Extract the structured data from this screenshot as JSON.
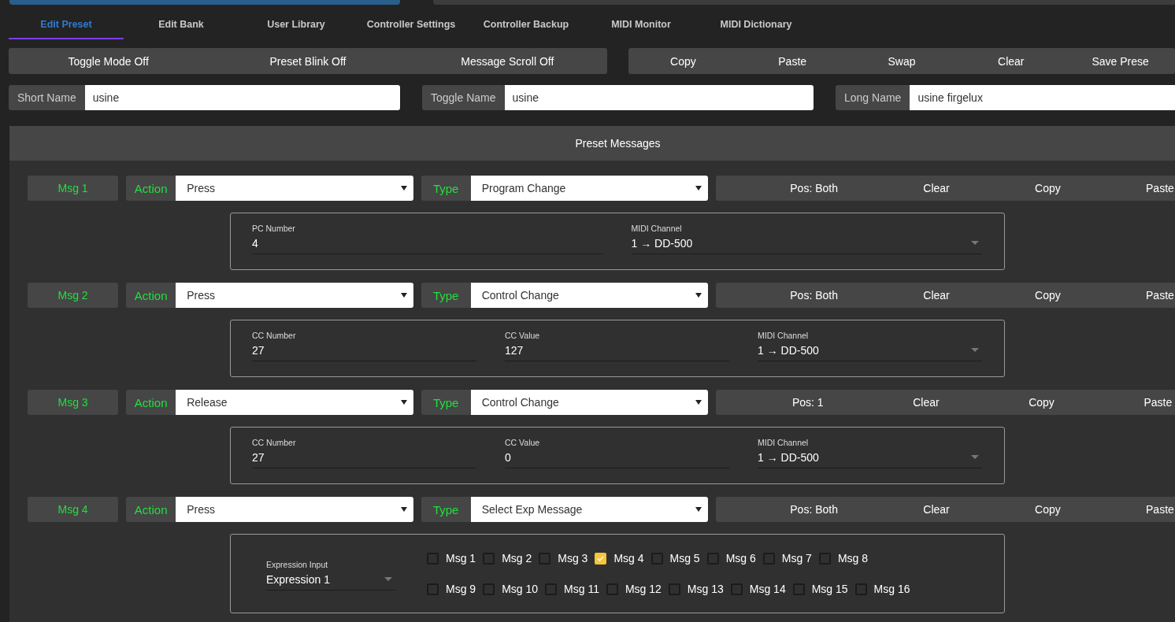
{
  "tabs": [
    {
      "label": "Edit Preset",
      "selected": true
    },
    {
      "label": "Edit Bank",
      "selected": false
    },
    {
      "label": "User Library",
      "selected": false
    },
    {
      "label": "Controller Settings",
      "selected": false
    },
    {
      "label": "Controller Backup",
      "selected": false
    },
    {
      "label": "MIDI Monitor",
      "selected": false
    },
    {
      "label": "MIDI Dictionary",
      "selected": false
    }
  ],
  "toolbar_left": [
    "Toggle Mode Off",
    "Preset Blink Off",
    "Message Scroll Off"
  ],
  "toolbar_right": [
    "Copy",
    "Paste",
    "Swap",
    "Clear",
    "Save Prese"
  ],
  "name_fields": [
    {
      "label": "Short Name",
      "value": "usine"
    },
    {
      "label": "Toggle Name",
      "value": "usine"
    },
    {
      "label": "Long Name",
      "value": "usine firgelux"
    }
  ],
  "panel": {
    "title": "Preset Messages",
    "messages": [
      {
        "label": "Msg 1",
        "action_label": "Action",
        "action": "Press",
        "type_label": "Type",
        "type": "Program Change",
        "buttons": [
          "Pos: Both",
          "Clear",
          "Copy",
          "Paste"
        ],
        "detail": {
          "kind": "fields",
          "fields": [
            {
              "kind": "text",
              "label": "PC Number",
              "value": "4"
            },
            {
              "kind": "select",
              "label": "MIDI Channel",
              "value": "1 → DD-500"
            }
          ]
        }
      },
      {
        "label": "Msg 2",
        "action_label": "Action",
        "action": "Press",
        "type_label": "Type",
        "type": "Control Change",
        "buttons": [
          "Pos: Both",
          "Clear",
          "Copy",
          "Paste"
        ],
        "detail": {
          "kind": "fields",
          "fields": [
            {
              "kind": "text",
              "label": "CC Number",
              "value": "27"
            },
            {
              "kind": "text",
              "label": "CC Value",
              "value": "127"
            },
            {
              "kind": "select",
              "label": "MIDI Channel",
              "value": "1 → DD-500"
            }
          ]
        }
      },
      {
        "label": "Msg 3",
        "action_label": "Action",
        "action": "Release",
        "type_label": "Type",
        "type": "Control Change",
        "buttons": [
          "Pos: 1",
          "Clear",
          "Copy",
          "Paste"
        ],
        "detail": {
          "kind": "fields",
          "fields": [
            {
              "kind": "text",
              "label": "CC Number",
              "value": "27"
            },
            {
              "kind": "text",
              "label": "CC Value",
              "value": "0"
            },
            {
              "kind": "select",
              "label": "MIDI Channel",
              "value": "1 → DD-500"
            }
          ]
        }
      },
      {
        "label": "Msg 4",
        "action_label": "Action",
        "action": "Press",
        "type_label": "Type",
        "type": "Select Exp Message",
        "buttons": [
          "Pos: Both",
          "Clear",
          "Copy",
          "Paste"
        ],
        "detail": {
          "kind": "expression",
          "input_label": "Expression Input",
          "input_value": "Expression 1",
          "checks": [
            {
              "label": "Msg 1",
              "checked": false
            },
            {
              "label": "Msg 2",
              "checked": false
            },
            {
              "label": "Msg 3",
              "checked": false
            },
            {
              "label": "Msg 4",
              "checked": true
            },
            {
              "label": "Msg 5",
              "checked": false
            },
            {
              "label": "Msg 6",
              "checked": false
            },
            {
              "label": "Msg 7",
              "checked": false
            },
            {
              "label": "Msg 8",
              "checked": false
            },
            {
              "label": "Msg 9",
              "checked": false
            },
            {
              "label": "Msg 10",
              "checked": false
            },
            {
              "label": "Msg 11",
              "checked": false
            },
            {
              "label": "Msg 12",
              "checked": false
            },
            {
              "label": "Msg 13",
              "checked": false
            },
            {
              "label": "Msg 14",
              "checked": false
            },
            {
              "label": "Msg 15",
              "checked": false
            },
            {
              "label": "Msg 16",
              "checked": false
            }
          ]
        }
      }
    ]
  }
}
